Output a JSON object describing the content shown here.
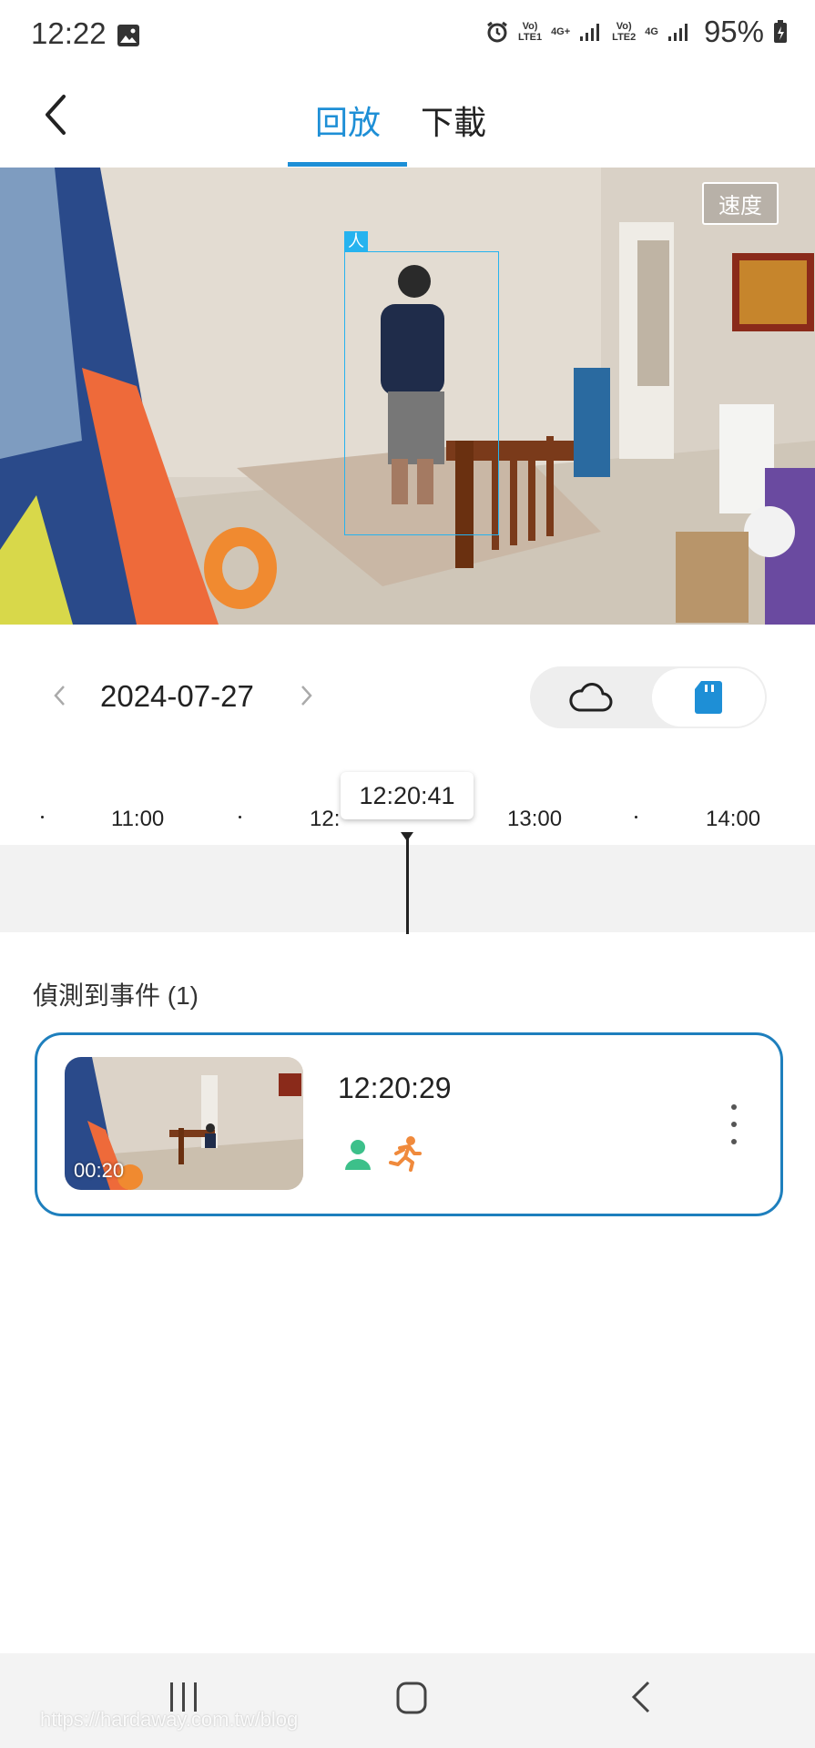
{
  "status_bar": {
    "time": "12:22",
    "sim1_line1": "Vo)",
    "sim1_line2": "LTE1",
    "sim1_net": "4G+",
    "sim2_line1": "Vo)",
    "sim2_line2": "LTE2",
    "sim2_net": "4G",
    "battery": "95%",
    "icons": [
      "gallery-icon",
      "alarm-icon",
      "signal-icon",
      "battery-icon"
    ]
  },
  "header": {
    "tabs": [
      {
        "label": "回放",
        "active": true
      },
      {
        "label": "下載",
        "active": false
      }
    ],
    "accent_color": "#1e8fd6"
  },
  "video": {
    "speed_label": "速度",
    "detection_label": "人"
  },
  "date_nav": {
    "date": "2024-07-27",
    "storage_options": [
      {
        "name": "cloud",
        "selected": false
      },
      {
        "name": "sd-card",
        "selected": true
      }
    ]
  },
  "timeline": {
    "ticks": [
      "·",
      "11:00",
      "·",
      "12:",
      "·",
      "13:00",
      "·",
      "14:00"
    ],
    "current_time": "12:20:41"
  },
  "events": {
    "title": "偵測到事件 (1)",
    "items": [
      {
        "duration": "00:20",
        "time": "12:20:29",
        "tags": [
          "person-icon",
          "motion-icon"
        ],
        "person_color": "#3cc08a",
        "motion_color": "#f08a3c"
      }
    ]
  },
  "footer": {
    "watermark": "https://hardaway.com.tw/blog"
  }
}
